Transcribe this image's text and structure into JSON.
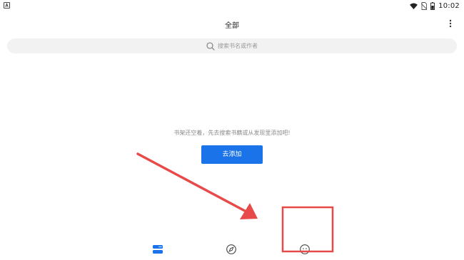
{
  "status_bar": {
    "time": "10:02",
    "icons": [
      "app-notification-icon",
      "wifi-icon",
      "no-sim-icon",
      "battery-icon"
    ]
  },
  "header": {
    "title": "全部",
    "more_icon": "more-vertical-icon"
  },
  "search": {
    "placeholder": "搜索书名或作者",
    "icon": "search-icon"
  },
  "empty_state": {
    "message": "书架还空着，先去搜索书籍或从发现里添加吧!",
    "button_label": "去添加"
  },
  "bottom_nav": {
    "items": [
      {
        "icon": "bookshelf-icon",
        "active": true
      },
      {
        "icon": "compass-icon",
        "active": false
      },
      {
        "icon": "smiley-icon",
        "active": false
      }
    ]
  },
  "colors": {
    "accent": "#1a73e8",
    "annotation": "#e84a4a",
    "search_bg": "#f2f2f2",
    "muted_text": "#8a8a8a"
  }
}
